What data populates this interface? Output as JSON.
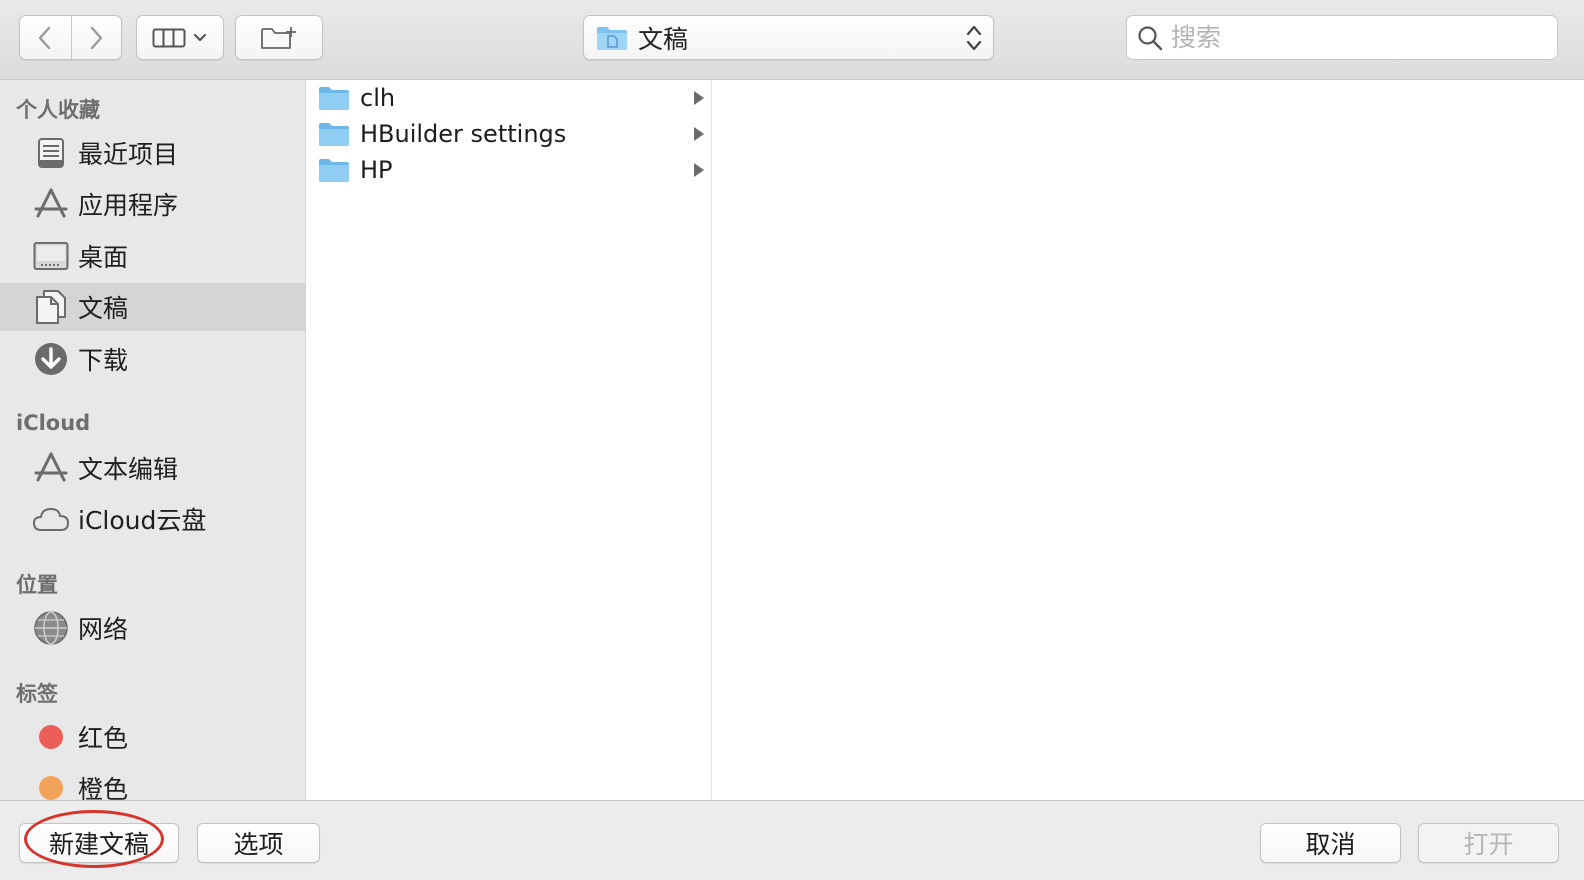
{
  "toolbar": {
    "back_icon": "chevron-left-icon",
    "forward_icon": "chevron-right-icon",
    "view_icon": "column-view-icon",
    "new_folder_icon": "new-folder-icon",
    "path": {
      "label": "文稿",
      "icon": "folder-documents-icon"
    },
    "search": {
      "placeholder": "搜索",
      "value": ""
    }
  },
  "sidebar": {
    "sections": [
      {
        "title": "个人收藏",
        "items": [
          {
            "label": "最近项目",
            "icon": "recents-icon"
          },
          {
            "label": "应用程序",
            "icon": "applications-icon"
          },
          {
            "label": "桌面",
            "icon": "desktop-icon"
          },
          {
            "label": "文稿",
            "icon": "documents-icon",
            "selected": true
          },
          {
            "label": "下载",
            "icon": "downloads-icon"
          }
        ]
      },
      {
        "title": "iCloud",
        "items": [
          {
            "label": "文本编辑",
            "icon": "applications-icon"
          },
          {
            "label": "iCloud云盘",
            "icon": "cloud-icon"
          }
        ]
      },
      {
        "title": "位置",
        "items": [
          {
            "label": "网络",
            "icon": "network-globe-icon"
          }
        ]
      },
      {
        "title": "标签",
        "items": [
          {
            "label": "红色",
            "color": "#ec5f59"
          },
          {
            "label": "橙色",
            "color": "#f2a35a"
          }
        ]
      }
    ]
  },
  "browser": {
    "column1": [
      {
        "name": "clh",
        "icon": "folder-icon"
      },
      {
        "name": "HBuilder settings",
        "icon": "folder-icon"
      },
      {
        "name": "HP",
        "icon": "folder-icon"
      }
    ]
  },
  "bottom": {
    "new_document": "新建文稿",
    "options": "选项",
    "cancel": "取消",
    "open": "打开"
  },
  "colors": {
    "folder": "#7cc3f0",
    "highlight_ring": "#d6332a",
    "selected_row": "#d5d5d5"
  }
}
